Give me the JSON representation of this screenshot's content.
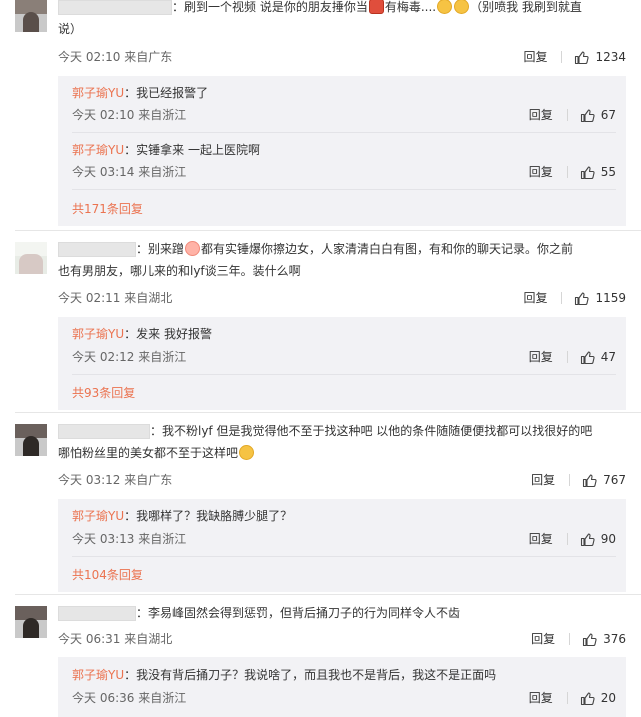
{
  "comments": [
    {
      "text_a": "：刷到一个视频 说是你的朋友捶你当",
      "text_b": "有梅毒....",
      "text_c": "（别喷我 我刷到就直",
      "text_d": "说）",
      "time": "今天 02:10 来自广东",
      "reply": "回复",
      "likes": "1234",
      "replies": [
        {
          "name": "郭子瑜YU",
          "text": "：我已经报警了",
          "time": "今天 02:10 来自浙江",
          "reply": "回复",
          "likes": "67"
        },
        {
          "name": "郭子瑜YU",
          "text": "：实锤拿来 一起上医院啊",
          "time": "今天 03:14 来自浙江",
          "reply": "回复",
          "likes": "55"
        }
      ],
      "more": "共171条回复"
    },
    {
      "text_a": "：别来蹭",
      "text_b": "都有实锤爆你擦边女，人家清清白白有图，有和你的聊天记录。你之前",
      "text_c": "也有男朋友，哪儿来的和lyf谈三年。装什么啊",
      "time": "今天 02:11 来自湖北",
      "reply": "回复",
      "likes": "1159",
      "replies": [
        {
          "name": "郭子瑜YU",
          "text": "：发来 我好报警",
          "time": "今天 02:12 来自浙江",
          "reply": "回复",
          "likes": "47"
        }
      ],
      "more": "共93条回复"
    },
    {
      "text_a": "：我不粉lyf 但是我觉得他不至于找这种吧 以他的条件随随便便找都可以找很好的吧",
      "text_b": "哪怕粉丝里的美女都不至于这样吧",
      "time": "今天 03:12 来自广东",
      "reply": "回复",
      "likes": "767",
      "replies": [
        {
          "name": "郭子瑜YU",
          "text": "：我哪样了？我缺胳膊少腿了？",
          "time": "今天 03:13 来自浙江",
          "reply": "回复",
          "likes": "90"
        }
      ],
      "more": "共104条回复"
    },
    {
      "text_a": "：李易峰固然会得到惩罚，但背后捅刀子的行为同样令人不齿",
      "time": "今天 06:31 来自湖北",
      "reply": "回复",
      "likes": "376",
      "replies": [
        {
          "name": "郭子瑜YU",
          "text": "：我没有背后捅刀子？我说啥了，而且我也不是背后，我这不是正面吗",
          "time": "今天 06:36 来自浙江",
          "reply": "回复",
          "likes": "20"
        }
      ]
    }
  ]
}
